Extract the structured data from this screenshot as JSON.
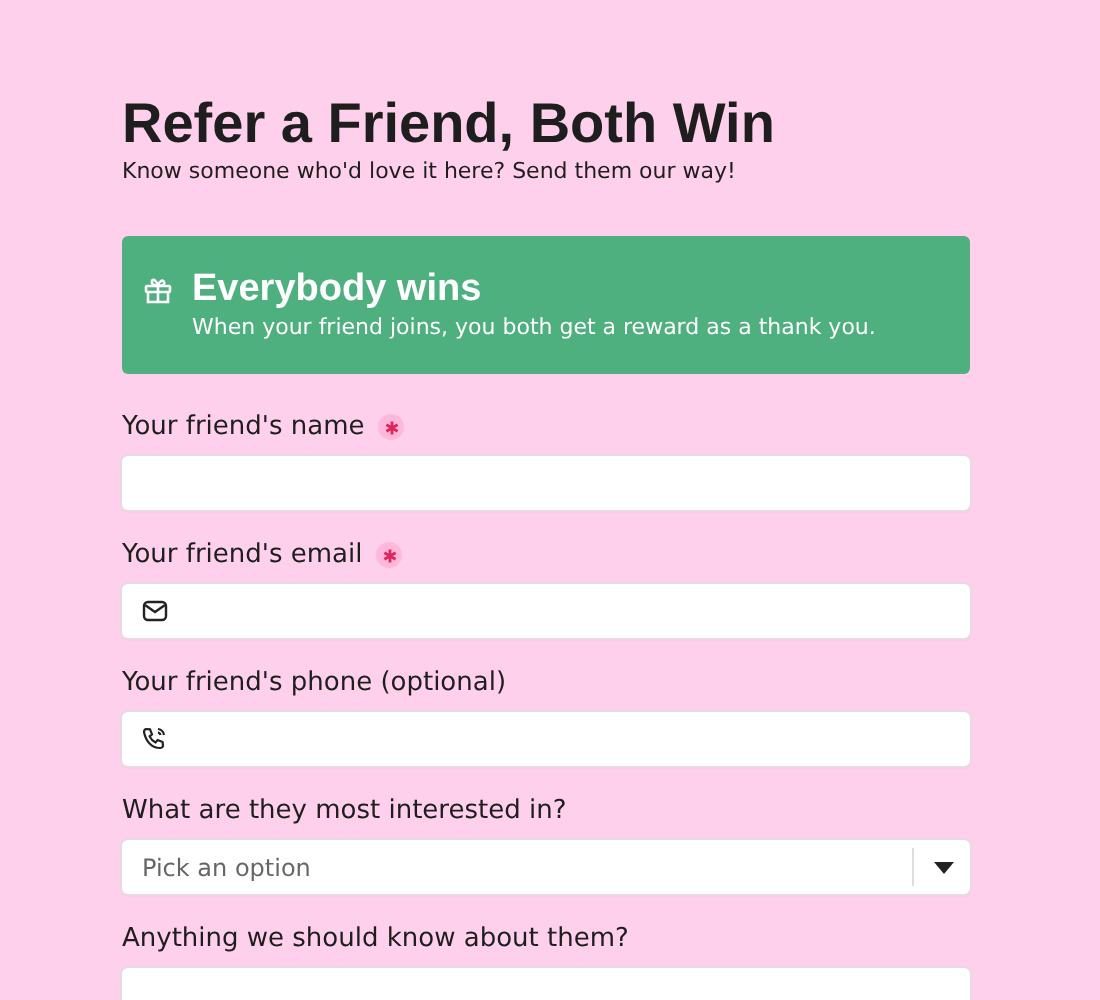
{
  "title": "Refer a Friend, Both Win",
  "subtitle": "Know someone who'd love it here? Send them our way!",
  "banner": {
    "title": "Everybody wins",
    "text": "When your friend joins, you both get a reward as a thank you."
  },
  "fields": [
    {
      "label": "Your friend's name",
      "required": true,
      "kind": "text"
    },
    {
      "label": "Your friend's email",
      "required": true,
      "kind": "email"
    },
    {
      "label": "Your friend's phone (optional)",
      "required": false,
      "kind": "phone"
    },
    {
      "label": "What are they most interested in?",
      "required": false,
      "kind": "select",
      "placeholder": "Pick an option"
    },
    {
      "label": "Anything we should know about them?",
      "required": false,
      "kind": "textarea"
    }
  ]
}
